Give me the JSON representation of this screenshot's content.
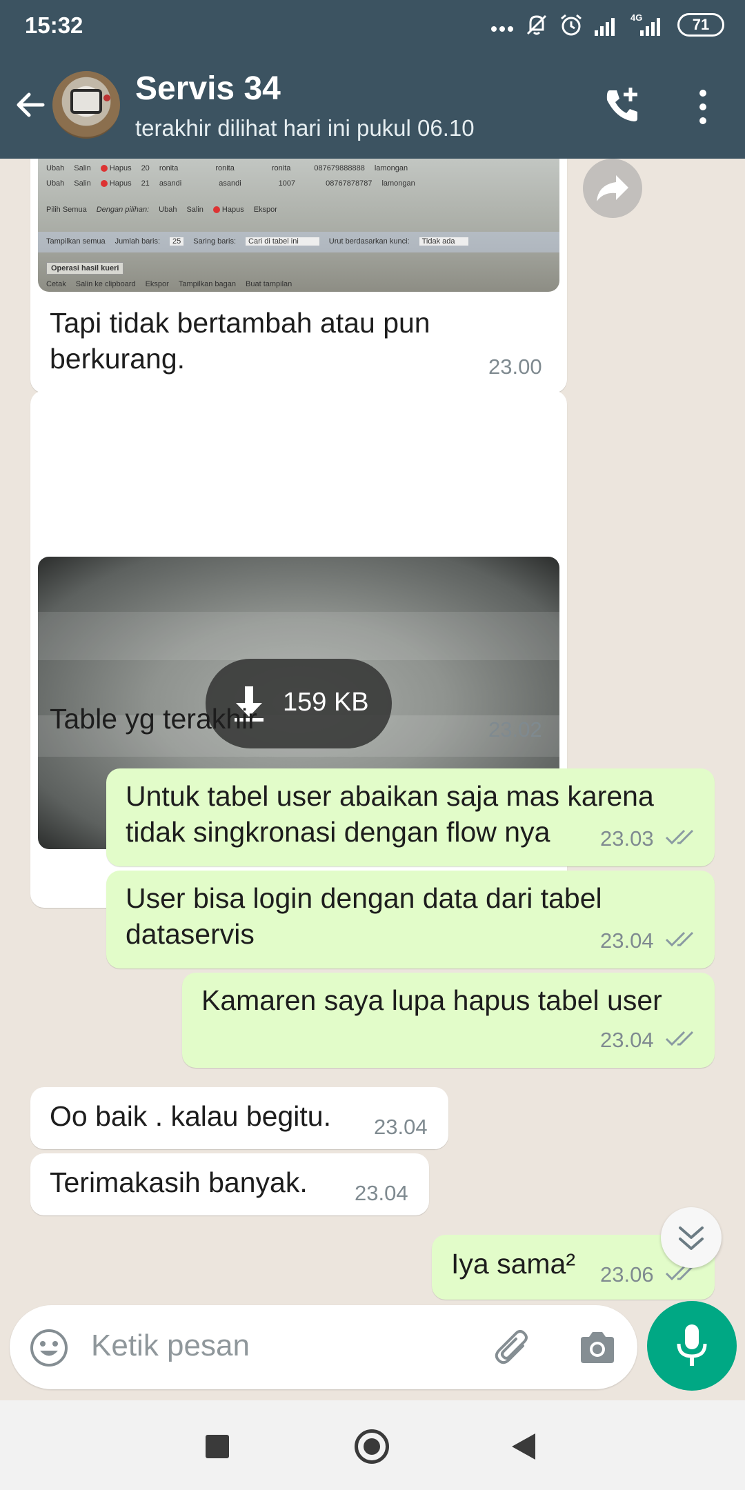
{
  "status_bar": {
    "time": "15:32",
    "battery": "71",
    "network": "4G",
    "icons": [
      "more-dots-icon",
      "silent-icon",
      "alarm-icon",
      "signal-icon",
      "signal-4g-icon",
      "battery-icon"
    ]
  },
  "header": {
    "contact_name": "Servis 34",
    "last_seen": "terakhir dilihat hari ini pukul 06.10",
    "icons": [
      "back-arrow-icon",
      "add-call-icon",
      "more-vert-icon"
    ]
  },
  "messages": [
    {
      "direction": "in",
      "type": "image-caption",
      "caption_lines": [
        "Tapi tidak bertambah atau pun",
        "berkurang."
      ],
      "time": "23.00",
      "image_text": {
        "rows": [
          [
            "Ubah",
            "Salin",
            "Hapus",
            "20",
            "ronita",
            "ronita",
            "ronita",
            "087679888888",
            "lamongan"
          ],
          [
            "Ubah",
            "Salin",
            "Hapus",
            "21",
            "asandi",
            "asandi",
            "1007",
            "08767878787",
            "lamongan"
          ]
        ],
        "select_all": [
          "Pilih Semua",
          "Dengan pilihan:",
          "Ubah",
          "Salin",
          "Hapus",
          "Ekspor"
        ],
        "controls": [
          "Tampilkan semua",
          "Jumlah baris:",
          "25",
          "Saring baris:",
          "Cari di tabel ini",
          "Urut berdasarkan kunci:",
          "Tidak ada"
        ],
        "section_title": "Operasi hasil kueri",
        "ops": [
          "Cetak",
          "Salin ke clipboard",
          "Ekspor",
          "Tampilkan bagan",
          "Buat tampilan"
        ]
      }
    },
    {
      "direction": "in",
      "type": "image-download",
      "download_size": "159 KB",
      "caption": "Table yg terakhir",
      "time": "23.02"
    },
    {
      "direction": "out",
      "lines": [
        "Untuk tabel user abaikan saja mas karena",
        "tidak singkronasi dengan flow nya"
      ],
      "time": "23.03",
      "status": "read"
    },
    {
      "direction": "out",
      "lines": [
        "User bisa login dengan data dari tabel",
        "dataservis"
      ],
      "time": "23.04",
      "status": "read"
    },
    {
      "direction": "out",
      "lines": [
        "Kamaren saya lupa hapus tabel user"
      ],
      "time": "23.04",
      "status": "read"
    },
    {
      "direction": "in",
      "lines": [
        "Oo baik . kalau begitu."
      ],
      "time": "23.04"
    },
    {
      "direction": "in",
      "lines": [
        "Terimakasih banyak."
      ],
      "time": "23.04"
    },
    {
      "direction": "out",
      "lines": [
        "Iya sama²"
      ],
      "time": "23.06",
      "status": "read"
    }
  ],
  "composer": {
    "placeholder": "Ketik pesan",
    "icons": [
      "emoji-icon",
      "attach-icon",
      "camera-icon",
      "mic-icon"
    ]
  },
  "colors": {
    "header_bg": "#3c5361",
    "chat_bg": "#ece5dd",
    "outgoing_bubble": "#e2fcc9",
    "incoming_bubble": "#ffffff",
    "accent": "#00a884",
    "read_ticks": "#8a9aa2"
  }
}
